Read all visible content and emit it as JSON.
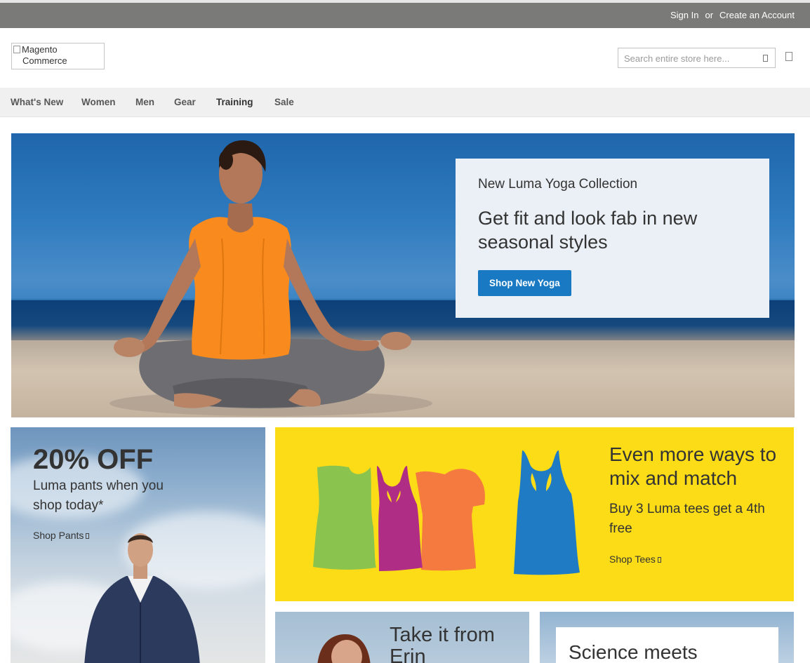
{
  "header": {
    "sign_in": "Sign In",
    "or": "or",
    "create_account": "Create an Account"
  },
  "logo": {
    "alt_line1": "Magento",
    "alt_line2": "Commerce"
  },
  "search": {
    "placeholder": "Search entire store here..."
  },
  "nav": {
    "items": [
      {
        "label": "What's New"
      },
      {
        "label": "Women"
      },
      {
        "label": "Men"
      },
      {
        "label": "Gear"
      },
      {
        "label": "Training"
      },
      {
        "label": "Sale"
      }
    ]
  },
  "hero": {
    "subtitle": "New Luma Yoga Collection",
    "title": "Get fit and look fab in new seasonal styles",
    "button": "Shop New Yoga"
  },
  "promo_pants": {
    "title": "20% OFF",
    "text": "Luma pants when you shop today*",
    "link": "Shop Pants"
  },
  "promo_tees": {
    "title": "Even more ways to mix and match",
    "text": "Buy 3 Luma tees get a 4th free",
    "link": "Shop Tees",
    "colors": {
      "green": "#8bc34f",
      "magenta": "#b02d86",
      "orange": "#f47a40",
      "blue": "#1f7bc4"
    }
  },
  "promo_erin": {
    "title": "Take it from Erin"
  },
  "promo_science": {
    "title": "Science meets"
  },
  "colors": {
    "header_bg": "#7a7a78",
    "nav_bg": "#f0f0f0",
    "primary_button": "#1979c3",
    "tees_bg": "#fcdc16"
  }
}
